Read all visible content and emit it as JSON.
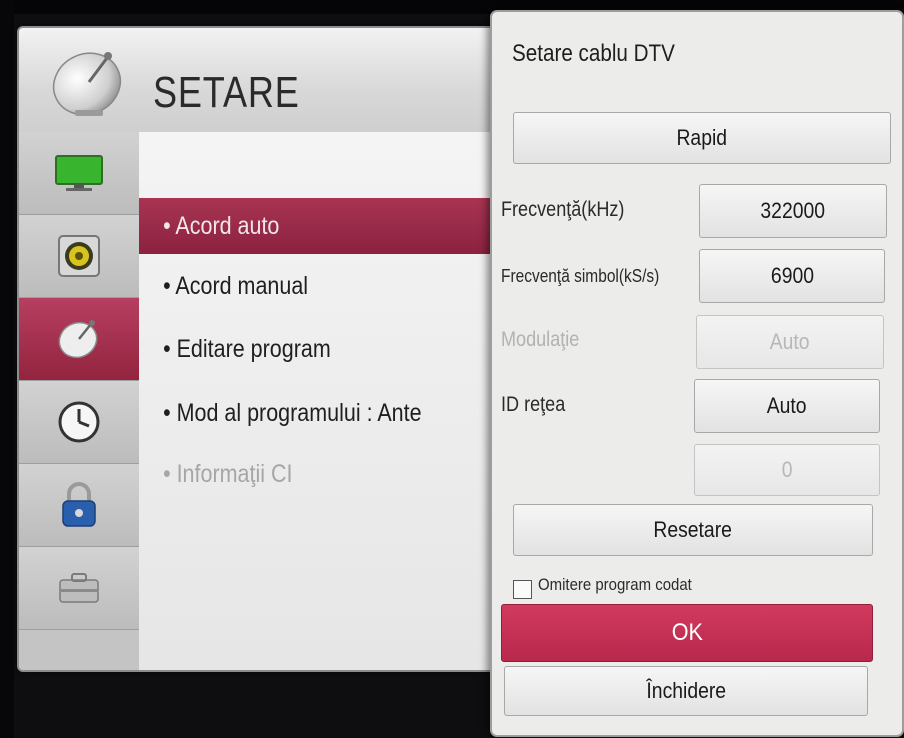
{
  "settings": {
    "title": "SETARE",
    "menu": [
      {
        "label": "• Acord auto",
        "state": "active"
      },
      {
        "label": "• Acord manual",
        "state": "normal"
      },
      {
        "label": "• Editare program",
        "state": "normal"
      },
      {
        "label": "• Mod al programului   :  Ante",
        "state": "normal"
      },
      {
        "label": "• Informaţii CI",
        "state": "disabled"
      }
    ],
    "categories": [
      "monitor-icon",
      "speaker-icon",
      "satellite-dish-icon",
      "clock-icon",
      "padlock-icon",
      "toolbox-icon"
    ],
    "active_category": "satellite-dish-icon"
  },
  "popup": {
    "title": "Setare cablu DTV",
    "mode": "Rapid",
    "fields": {
      "frequency_label": "Frecvenţă(kHz)",
      "frequency_value": "322000",
      "symbol_rate_label": "Frecvenţă simbol(kS/s)",
      "symbol_rate_value": "6900",
      "modulation_label": "Modulaţie",
      "modulation_value": "Auto",
      "network_id_label": "ID reţea",
      "network_id_value": "Auto",
      "network_id_number": "0"
    },
    "reset_label": "Resetare",
    "skip_encrypted_label": "Omitere program codat",
    "skip_encrypted_checked": false,
    "ok_label": "OK",
    "close_label": "Închidere"
  },
  "colors": {
    "accent": "#c52f55",
    "highlight": "#9a2846",
    "panel": "#ececea"
  }
}
